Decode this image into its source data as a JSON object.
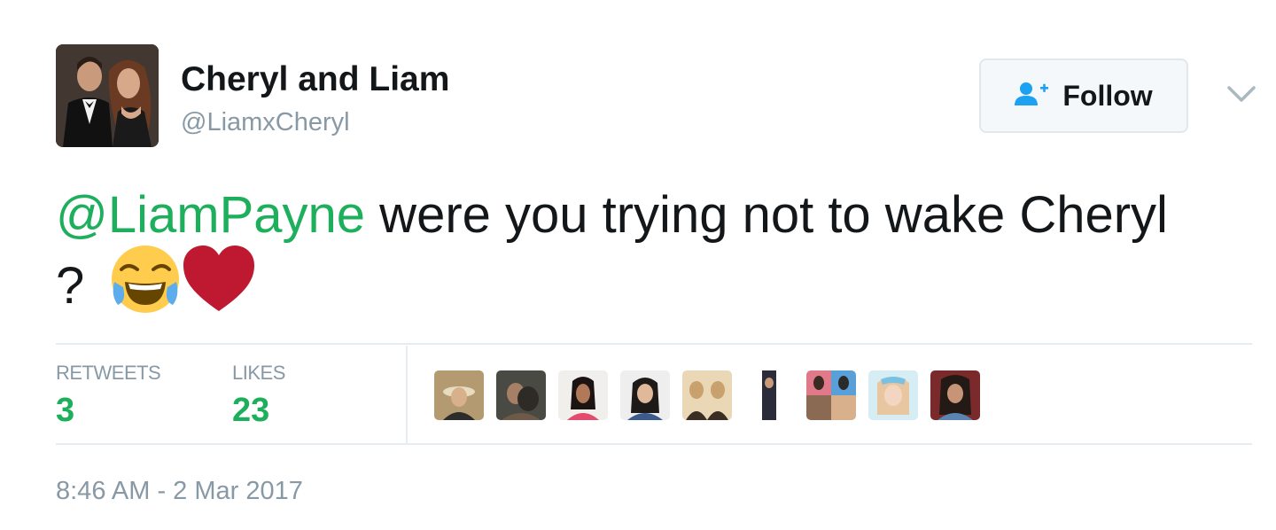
{
  "author": {
    "name": "Cheryl and Liam",
    "handle": "@LiamxCheryl"
  },
  "follow_button": {
    "label": "Follow",
    "icon": "add-user-icon"
  },
  "menu": {
    "icon": "chevron-down-icon"
  },
  "tweet": {
    "mention": "@LiamPayne",
    "text": " were you trying not to wake Cheryl",
    "line2": "?",
    "emojis": [
      "face-with-tears-of-joy",
      "red-heart"
    ]
  },
  "stats": {
    "retweets_label": "RETWEETS",
    "retweets_value": "3",
    "likes_label": "LIKES",
    "likes_value": "23"
  },
  "likers_count_shown": 9,
  "timestamp": "8:46 AM - 2 Mar 2017",
  "colors": {
    "accent_green": "#1daf5c",
    "secondary_text": "#8899a6",
    "follow_icon_blue": "#1da1f2",
    "heart_red": "#be1931"
  }
}
